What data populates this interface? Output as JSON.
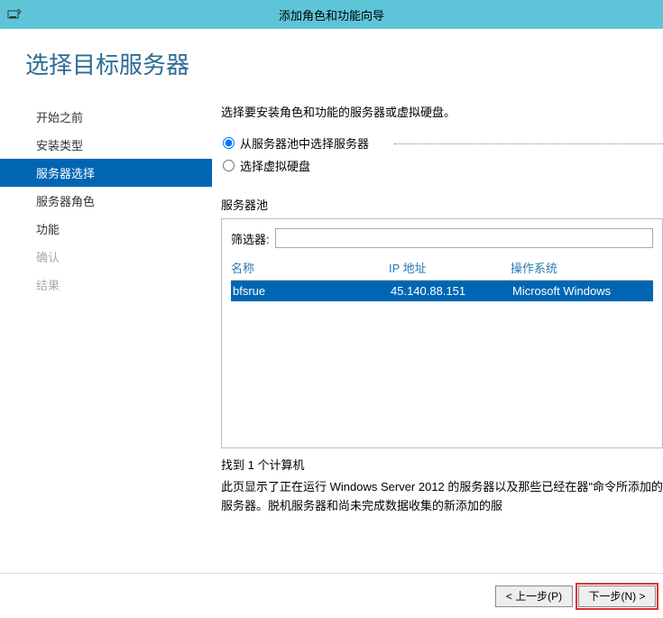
{
  "titlebar": {
    "title": "添加角色和功能向导"
  },
  "page": {
    "title": "选择目标服务器"
  },
  "sidebar": {
    "items": [
      {
        "label": "开始之前",
        "state": "normal"
      },
      {
        "label": "安装类型",
        "state": "normal"
      },
      {
        "label": "服务器选择",
        "state": "selected"
      },
      {
        "label": "服务器角色",
        "state": "normal"
      },
      {
        "label": "功能",
        "state": "normal"
      },
      {
        "label": "确认",
        "state": "disabled"
      },
      {
        "label": "结果",
        "state": "disabled"
      }
    ]
  },
  "panel": {
    "instruction": "选择要安装角色和功能的服务器或虚拟硬盘。",
    "radios": {
      "pool": "从服务器池中选择服务器",
      "vhd": "选择虚拟硬盘",
      "selected": "pool"
    },
    "pool_label": "服务器池",
    "filter": {
      "label": "筛选器:",
      "value": ""
    },
    "columns": {
      "name": "名称",
      "ip": "IP 地址",
      "os": "操作系统"
    },
    "rows": [
      {
        "name": "bfsrue",
        "ip": "45.140.88.151",
        "os": "Microsoft Windows"
      }
    ],
    "count": "找到 1 个计算机",
    "description": "此页显示了正在运行 Windows Server 2012 的服务器以及那些已经在器\"命令所添加的服务器。脱机服务器和尚未完成数据收集的新添加的服"
  },
  "footer": {
    "prev": "< 上一步(P)",
    "next": "下一步(N) >"
  }
}
